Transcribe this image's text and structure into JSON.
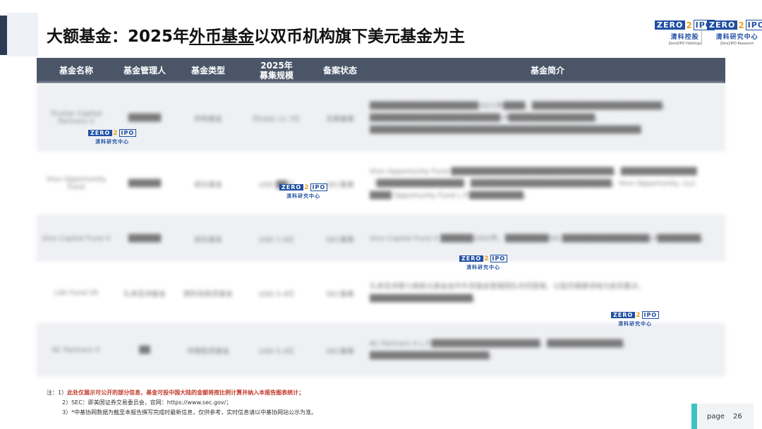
{
  "header": {
    "title_prefix": "大额基金：2025年",
    "title_underlined": "外币基金",
    "title_suffix": "以双币机构旗下美元基金为主"
  },
  "logos": {
    "holdings": {
      "mark_zero": "ZERO",
      "mark_two": "2",
      "mark_ipo": "IPO",
      "cn": "清科控股",
      "en": "Zero2IPO Holdings"
    },
    "research": {
      "mark_zero": "ZERO",
      "mark_two": "2",
      "mark_ipo": "IPO",
      "cn": "清科研究中心",
      "en": "Zero2IPO Research"
    }
  },
  "table": {
    "headers": [
      "基金名称",
      "基金管理人",
      "基金类型",
      "2025年\n募集规模",
      "备案状态",
      "基金简介"
    ],
    "rows": [
      [
        "Trustar Capital Partners V",
        "██████",
        "并购基金",
        "约USD 11.7亿",
        "无需备案",
        "████████████████████2021年████，████████████████████████。████████████████████████LP████████████████。██████████████████████████████████████████████████"
      ],
      [
        "Vivo Opportunity Fund",
        "██████",
        "成长基金",
        "USD ██亿",
        "SEC备案",
        "Vivo Opportunity Fund ██████████████████████████████，██████████████（████████████████）██████████████████████████。Vivo Opportunity, LLC ████ Opportunity Fund L.P.██████████。"
      ],
      [
        "Vivo Capital Fund X",
        "██████",
        "成长基金",
        "USD 7.9亿",
        "SEC备案",
        "Vivo Capital Fund X ██████2002年，████████SEC████████████████LP████████。"
      ],
      [
        "LAV Fund VII",
        "礼来亚洲基金",
        "跨阶段投资基金",
        "USD 5.4亿",
        "SEC备案",
        "礼来亚洲第七期美元基金由中外资基金管理团队共同管理，以医药健康领域为投资重点，███████████████████。"
      ],
      [
        "KC Partners X",
        "██",
        "早期投资基金",
        "USD 5.4亿",
        "SEC备案",
        "KC Partners X L.P.████████████████████，██████████████，██████████████████████。"
      ]
    ]
  },
  "notes": {
    "n1_prefix": "注：1）",
    "n1_text": "此处仅展示可公开的部分信息，基金可投中国大陆的金额将按比例计算并纳入本报告图表统计；",
    "n2": "2）SEC：即美国证券交易委员会，官网：https://www.sec.gov/；",
    "n3": "3）*中基协网数据为截至本报告撰写完成时最新信息，仅供参考，实时信息请以中基协网站公示为准。"
  },
  "footer": {
    "page_label": "page",
    "page_number": "26"
  },
  "colors": {
    "header_bg": "#4a5568",
    "accent_teal": "#3cc4c4",
    "brand_blue": "#1f4fa3",
    "note_red": "#c0392b"
  }
}
